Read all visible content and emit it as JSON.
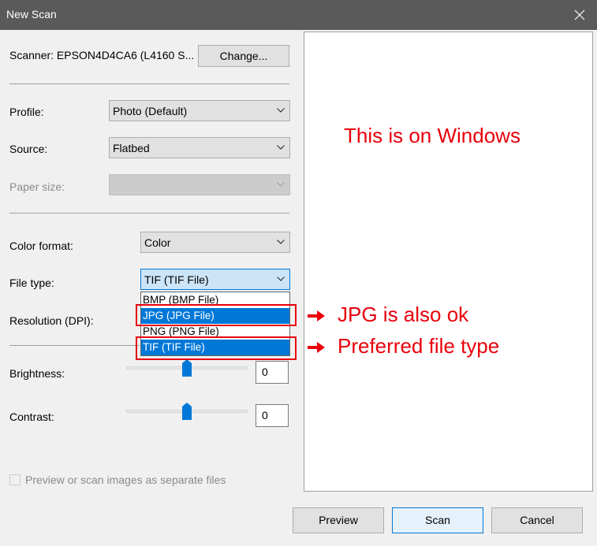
{
  "window": {
    "title": "New Scan"
  },
  "scanner": {
    "label": "Scanner: EPSON4D4CA6 (L4160 S...",
    "change_label": "Change..."
  },
  "profile": {
    "label": "Profile:",
    "value": "Photo (Default)"
  },
  "source": {
    "label": "Source:",
    "value": "Flatbed"
  },
  "paper_size": {
    "label": "Paper size:",
    "value": ""
  },
  "color_format": {
    "label": "Color format:",
    "value": "Color"
  },
  "file_type": {
    "label": "File type:",
    "value": "TIF (TIF File)",
    "options": [
      "BMP (BMP File)",
      "JPG (JPG File)",
      "PNG (PNG File)",
      "TIF (TIF File)"
    ],
    "highlighted": [
      "JPG (JPG File)",
      "TIF (TIF File)"
    ]
  },
  "resolution": {
    "label": "Resolution (DPI):"
  },
  "brightness": {
    "label": "Brightness:",
    "value": "0",
    "level": 0.5
  },
  "contrast": {
    "label": "Contrast:",
    "value": "0",
    "level": 0.5
  },
  "separate_files": {
    "label": "Preview or scan images as separate files",
    "checked": false
  },
  "buttons": {
    "preview": "Preview",
    "scan": "Scan",
    "cancel": "Cancel"
  },
  "annotations": {
    "windows_note": "This is on Windows",
    "jpg_note": "JPG is also ok",
    "tif_note": "Preferred file type",
    "color": "#e8000b"
  },
  "icons": {
    "close": "close-icon",
    "chevron": "chevron-down-icon",
    "arrow": "arrow-right-icon"
  }
}
